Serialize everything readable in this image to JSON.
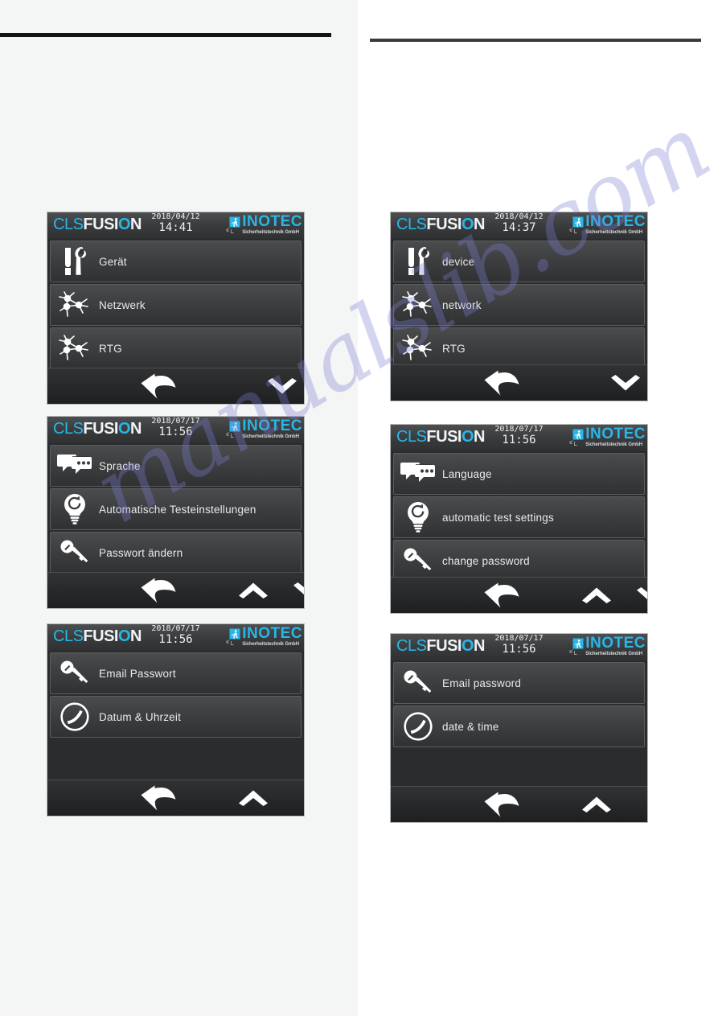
{
  "document": {
    "watermark": "manualslib.com",
    "brand": {
      "cls": "CLS",
      "fus": "FUSI",
      "o": "O",
      "n": "N"
    },
    "logo": {
      "name": "INOTEC",
      "tagline": "Sicherheitstechnik GmbH"
    },
    "colors": {
      "accent_cyan": "#29b6e8",
      "screen_bg": "#2b2c2e",
      "row_text": "#e9eaeb",
      "page_left_bg": "#f4f5f5",
      "page_right_bg": "#ffffff",
      "rule_dark": "#111315",
      "watermark": "#7d7fd2"
    }
  },
  "screens": [
    {
      "id": "de-main-menu",
      "date": "2018/04/12",
      "time": "14:41",
      "rows": [
        {
          "label": "Gerät",
          "icon": "tools-icon"
        },
        {
          "label": "Netzwerk",
          "icon": "network-icon"
        },
        {
          "label": "RTG",
          "icon": "network-icon"
        }
      ],
      "nav": [
        {
          "name": "back-button",
          "icon": "back-arrow-icon"
        },
        {
          "name": "scroll-down-button",
          "icon": "chevron-down-icon"
        }
      ]
    },
    {
      "id": "de-settings-page-1",
      "date": "2018/07/17",
      "time": "11:56",
      "rows": [
        {
          "label": "Sprache",
          "icon": "speech-bubbles-icon"
        },
        {
          "label": "Automatische Testeinstellungen",
          "icon": "lightbulb-icon"
        },
        {
          "label": "Passwort ändern",
          "icon": "key-icon"
        }
      ],
      "nav": [
        {
          "name": "back-button",
          "icon": "back-arrow-icon"
        },
        {
          "name": "scroll-up-button",
          "icon": "chevron-up-icon"
        },
        {
          "name": "scroll-down-button",
          "icon": "chevron-down-icon"
        }
      ]
    },
    {
      "id": "de-settings-page-2",
      "date": "2018/07/17",
      "time": "11:56",
      "rows": [
        {
          "label": "Email Passwort",
          "icon": "key-icon"
        },
        {
          "label": "Datum & Uhrzeit",
          "icon": "clock-icon"
        }
      ],
      "nav": [
        {
          "name": "back-button",
          "icon": "back-arrow-icon"
        },
        {
          "name": "scroll-up-button",
          "icon": "chevron-up-icon"
        }
      ]
    },
    {
      "id": "en-main-menu",
      "date": "2018/04/12",
      "time": "14:37",
      "rows": [
        {
          "label": "device",
          "icon": "tools-icon"
        },
        {
          "label": "network",
          "icon": "network-icon"
        },
        {
          "label": "RTG",
          "icon": "network-icon"
        }
      ],
      "nav": [
        {
          "name": "back-button",
          "icon": "back-arrow-icon"
        },
        {
          "name": "scroll-down-button",
          "icon": "chevron-down-icon"
        }
      ]
    },
    {
      "id": "en-settings-page-1",
      "date": "2018/07/17",
      "time": "11:56",
      "rows": [
        {
          "label": "Language",
          "icon": "speech-bubbles-icon"
        },
        {
          "label": "automatic test settings",
          "icon": "lightbulb-icon"
        },
        {
          "label": "change password",
          "icon": "key-icon"
        }
      ],
      "nav": [
        {
          "name": "back-button",
          "icon": "back-arrow-icon"
        },
        {
          "name": "scroll-up-button",
          "icon": "chevron-up-icon"
        },
        {
          "name": "scroll-down-button",
          "icon": "chevron-down-icon"
        }
      ]
    },
    {
      "id": "en-settings-page-2",
      "date": "2018/07/17",
      "time": "11:56",
      "rows": [
        {
          "label": "Email password",
          "icon": "key-icon"
        },
        {
          "label": "date & time",
          "icon": "clock-icon"
        }
      ],
      "nav": [
        {
          "name": "back-button",
          "icon": "back-arrow-icon"
        },
        {
          "name": "scroll-up-button",
          "icon": "chevron-up-icon"
        }
      ]
    }
  ]
}
